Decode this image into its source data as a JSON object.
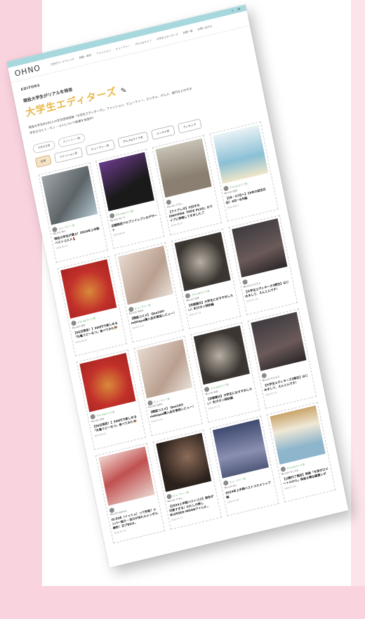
{
  "header": {
    "logo": "OHNO",
    "nav": [
      "Z世代マーケティング",
      "就職・進学",
      "ファッション",
      "ビューティー",
      "グルメ&ライフ",
      "大学生エディターズ",
      "記事一覧",
      "お問い合わせ"
    ]
  },
  "hero": {
    "section_label": "EDITORS",
    "tagline": "現役大学生がリアルを発信",
    "title": "大学生エディターズ",
    "description": "現役大学生約100人の学生団体組織「大学生エディターズ」。ファッション、ビューティー、エンタメ、グルメ、旅行などの今大学生ならヒト・モノ・コトについて執筆を発信中！"
  },
  "subtabs": [
    "今月の企画",
    "エントリー一覧"
  ],
  "categories": [
    "全体",
    "ファッション系",
    "ビューティー系",
    "グルメ&ライフ系",
    "エンタメ系",
    "ランキング"
  ],
  "colors": {
    "accent": "#e7b84a",
    "topbar": "#a7d8de",
    "category": "#58a55c",
    "page_bg": "#f9d3de"
  },
  "cards": [
    {
      "category": "ビューティー系",
      "author": "Mu-ichi Pyu",
      "title": "現役大学生が選ぶ！2024年上半期ベストコスメ💄",
      "date": "2024.08.14"
    },
    {
      "category": "グルメ&ライフ系",
      "author": "Mu-ichi ゆいり",
      "title": "店舗限定!?セブンイレブンのデザート",
      "date": "2024.08.09"
    },
    {
      "category": "",
      "author": "Mu-ichi りきん",
      "title": "【ライブレポ】大好きなENHYPEN「FATE PLUS」のライブに参戦してきました🎵",
      "date": "2024.08.07"
    },
    {
      "category": "グルメ&ライフ系",
      "author": "Mu-ichi 加羽",
      "title": "【28・27日へ】25年の就活日記！6月〜8月編",
      "date": "2024.08.01"
    },
    {
      "category": "グルメ&ライフ系",
      "author": "Mu-ichi 古月",
      "title": "【SS日限定！】300円で楽しめる「丸亀うどーなつ」食べてみた🍩",
      "date": "2024.08.03"
    },
    {
      "category": "ビューティー系",
      "author": "Mu-ichi SAPU",
      "title": "【韓国コスメ】 Qoo10のmdsique購入品を徹底レビュー！",
      "date": "2024.07.26"
    },
    {
      "category": "グルメ&ライフ系",
      "author": "Mu-ichi 古月",
      "title": "【京都観光】大学生におすすめしたい！町ガタン探訪編",
      "date": "2024.07.23"
    },
    {
      "category": "",
      "author": "Mu-ichi たえええ",
      "title": "【大学生エディターズ3期生】はじめまして、えんとんです！",
      "date": "2024.07.19"
    },
    {
      "category": "グルメ&ライフ系",
      "author": "Mu-ichi 古月",
      "title": "【SS日限定！】300円で楽しめる「丸亀うどーなつ」食べてみた🍩",
      "date": "2024.08.03"
    },
    {
      "category": "ビューティー系",
      "author": "Mu-ichi SAPU",
      "title": "【韓国コスメ】 Qoo10のmdsique購入品を徹底レビュー！",
      "date": "2024.07.26"
    },
    {
      "category": "グルメ&ライフ系",
      "author": "Mu-ichi 古月",
      "title": "【京都観光】大学生におすすめしたい！町ガタン探訪編",
      "date": "2024.07.23"
    },
    {
      "category": "",
      "author": "Mu-ichi たえええ",
      "title": "【大学生エディターズ3期生】はじめまして、えんとんです！",
      "date": "2024.07.19"
    },
    {
      "category": "",
      "author": "Mu-ichi Sakumi",
      "title": "IS:SUE（イッシュ）って何者？メンバー紹介・自分が当たルシンダル解析！日プ8以4..",
      "date": "2024.07.16"
    },
    {
      "category": "ビューティー系",
      "author": "Mu-ichi りきん",
      "title": "【2024上半期ベストコス】発色が可愛すぎる！わたしの推し BLESSED MOONアイムル..",
      "date": "2024.07.12"
    },
    {
      "category": "ビューティー系",
      "author": "Mu-ichi ねこ",
      "title": "2024年上半期ベストコスメリップ編",
      "date": "2024.07.05"
    },
    {
      "category": "グルメ&ライフ系",
      "author": "Mu-ichi ちしえる",
      "title": "【公開代了間近】映画「水深ゼロメートルから」映画＆舞台鑑賞レポ",
      "date": "2024.07.02"
    }
  ]
}
